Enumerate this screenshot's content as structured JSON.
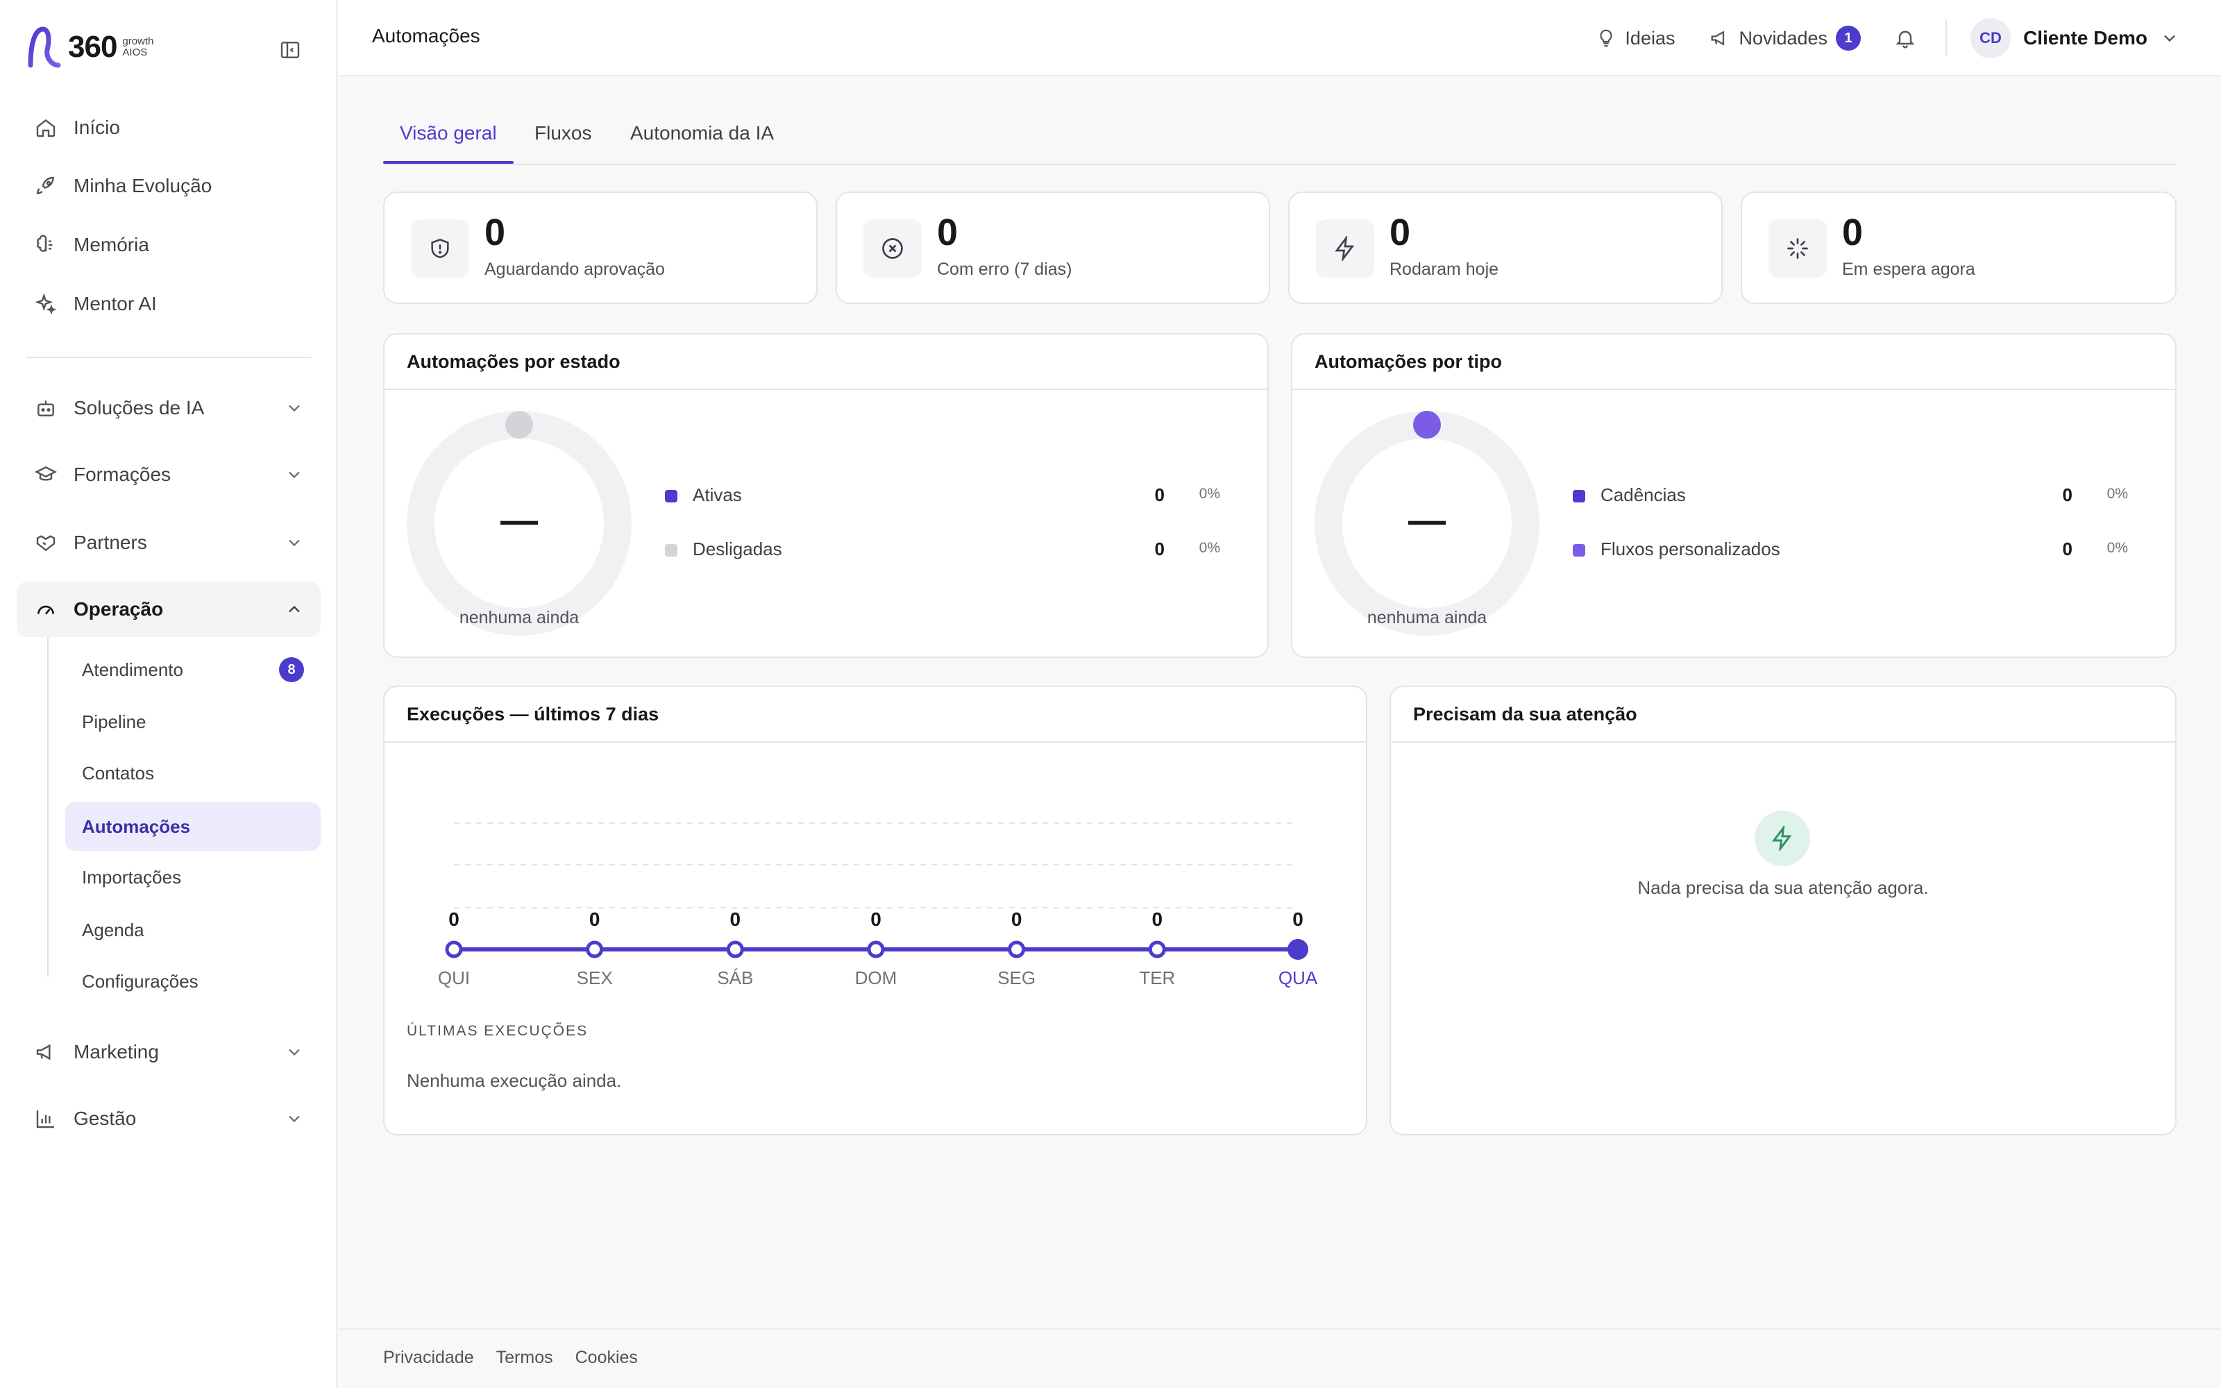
{
  "brand": {
    "name": "360",
    "sub_top": "growth",
    "sub_bottom": "AIOS"
  },
  "sidebar": {
    "primary": [
      {
        "label": "Início",
        "icon": "home-icon"
      },
      {
        "label": "Minha Evolução",
        "icon": "rocket-icon"
      },
      {
        "label": "Memória",
        "icon": "brain-icon"
      },
      {
        "label": "Mentor AI",
        "icon": "sparkles-icon"
      }
    ],
    "groups": [
      {
        "label": "Soluções de IA",
        "icon": "bot-icon",
        "expanded": false
      },
      {
        "label": "Formações",
        "icon": "graduation-cap-icon",
        "expanded": false
      },
      {
        "label": "Partners",
        "icon": "handshake-icon",
        "expanded": false
      },
      {
        "label": "Operação",
        "icon": "gauge-icon",
        "expanded": true
      },
      {
        "label": "Marketing",
        "icon": "megaphone-icon",
        "expanded": false
      },
      {
        "label": "Gestão",
        "icon": "bar-chart-icon",
        "expanded": false
      }
    ],
    "operacao_items": [
      {
        "label": "Atendimento",
        "badge": "8"
      },
      {
        "label": "Pipeline"
      },
      {
        "label": "Contatos"
      },
      {
        "label": "Automações",
        "active": true
      },
      {
        "label": "Importações"
      },
      {
        "label": "Agenda"
      },
      {
        "label": "Configurações"
      }
    ]
  },
  "topbar": {
    "title": "Automações",
    "ideas": "Ideias",
    "news": "Novidades",
    "news_count": "1",
    "avatar_initials": "CD",
    "user_name": "Cliente Demo"
  },
  "tabs": [
    {
      "label": "Visão geral",
      "active": true
    },
    {
      "label": "Fluxos"
    },
    {
      "label": "Autonomia da IA"
    }
  ],
  "stats": [
    {
      "value": "0",
      "label": "Aguardando aprovação",
      "icon": "shield-alert-icon"
    },
    {
      "value": "0",
      "label": "Com erro (7 dias)",
      "icon": "x-circle-icon"
    },
    {
      "value": "0",
      "label": "Rodaram hoje",
      "icon": "zap-icon"
    },
    {
      "value": "0",
      "label": "Em espera agora",
      "icon": "loader-icon"
    }
  ],
  "by_state": {
    "title": "Automações por estado",
    "center": "—",
    "center_sub": "nenhuma ainda",
    "legend": [
      {
        "label": "Ativas",
        "value": "0",
        "pct": "0%",
        "color": "#4b3ccd"
      },
      {
        "label": "Desligadas",
        "value": "0",
        "pct": "0%",
        "color": "#d4d4d8"
      }
    ]
  },
  "by_type": {
    "title": "Automações por tipo",
    "center": "—",
    "center_sub": "nenhuma ainda",
    "legend": [
      {
        "label": "Cadências",
        "value": "0",
        "pct": "0%",
        "color": "#4b3ccd"
      },
      {
        "label": "Fluxos personalizados",
        "value": "0",
        "pct": "0%",
        "color": "#7b5ce6"
      }
    ]
  },
  "executions": {
    "title": "Execuções — últimos 7 dias",
    "recent_title": "ÚLTIMAS EXECUÇÕES",
    "empty": "Nenhuma execução ainda."
  },
  "attention": {
    "title": "Precisam da sua atenção",
    "empty": "Nada precisa da sua atenção agora.",
    "icon": "zap-icon"
  },
  "footer": {
    "links": [
      "Privacidade",
      "Termos",
      "Cookies"
    ]
  },
  "colors": {
    "accent": "#4b3ccd",
    "accent_light": "#ecebfb",
    "success_bg": "#dff3ea",
    "success": "#2f8f63"
  },
  "chart_data": {
    "type": "line",
    "categories": [
      "QUI",
      "SEX",
      "SÁB",
      "DOM",
      "SEG",
      "TER",
      "QUA"
    ],
    "series": [
      {
        "values": [
          0,
          0,
          0,
          0,
          0,
          0,
          0
        ]
      }
    ],
    "value_labels": [
      "0",
      "0",
      "0",
      "0",
      "0",
      "0",
      "0"
    ],
    "highlight_category": "QUA",
    "grid": true
  }
}
